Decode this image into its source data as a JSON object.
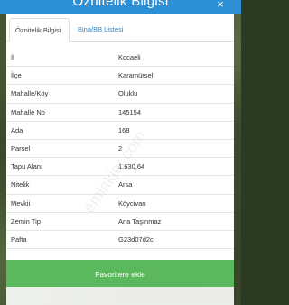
{
  "window": {
    "title": "Öznitelik Bilgisi",
    "close_symbol": "×"
  },
  "tabs": [
    {
      "label": "Öznitelik Bilgisi",
      "active": true
    },
    {
      "label": "Bina/BB Listesi",
      "active": false
    }
  ],
  "attributes": [
    {
      "label": "İl",
      "value": "Kocaeli"
    },
    {
      "label": "İlçe",
      "value": "Karamürsel"
    },
    {
      "label": "Mahalle/Köy",
      "value": "Oluklu"
    },
    {
      "label": "Mahalle No",
      "value": "145154"
    },
    {
      "label": "Ada",
      "value": "168"
    },
    {
      "label": "Parsel",
      "value": "2"
    },
    {
      "label": "Tapu Alanı",
      "value": "1.630,64"
    },
    {
      "label": "Nitelik",
      "value": "Arsa"
    },
    {
      "label": "Mevkii",
      "value": "Köycivarı"
    },
    {
      "label": "Zemin Tip",
      "value": "Ana Taşınmaz"
    },
    {
      "label": "Pafta",
      "value": "G23d07d2c"
    }
  ],
  "actions": {
    "favorite_label": "Favorilere ekle"
  },
  "watermark": "emlakjet.com",
  "colors": {
    "header": "#2d8fd6",
    "tab_link": "#2f86c8",
    "favorite_button": "#5cb85c"
  }
}
